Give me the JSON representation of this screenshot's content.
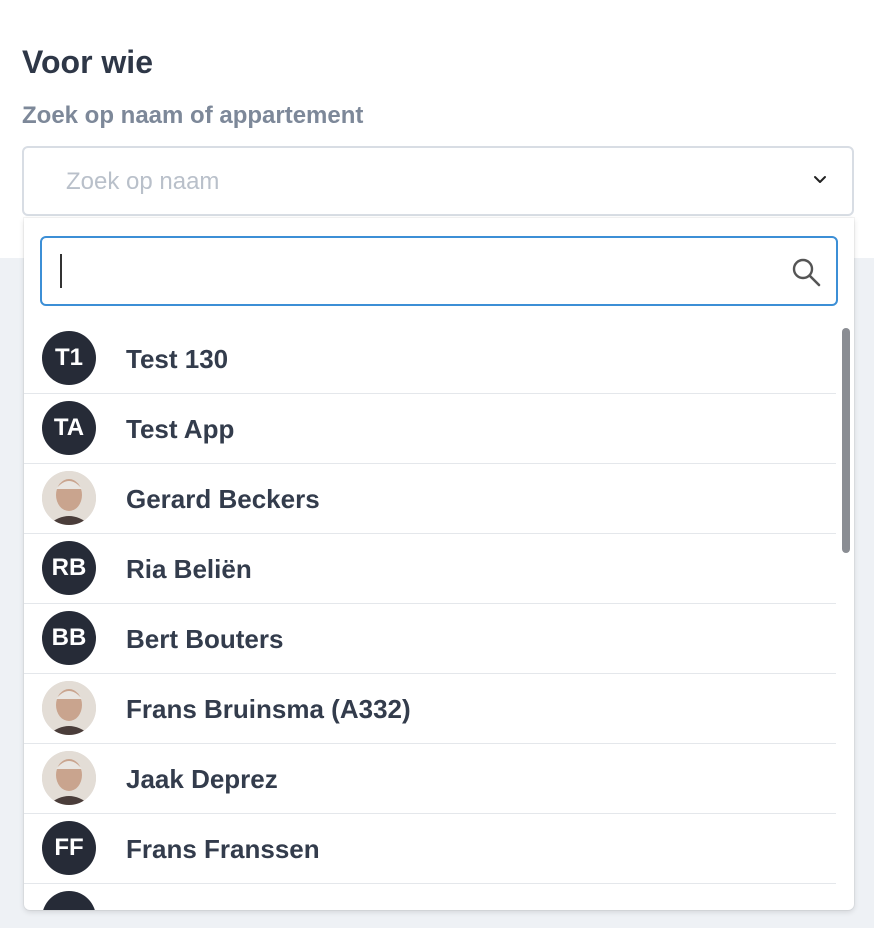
{
  "header": {
    "title": "Voor wie",
    "subtitle": "Zoek op naam of appartement"
  },
  "select": {
    "placeholder": "Zoek op naam",
    "chevron_icon": "chevron-down-icon"
  },
  "search": {
    "value": "",
    "icon": "search-icon"
  },
  "people": [
    {
      "initials": "T1",
      "name": "Test 130",
      "photo": false
    },
    {
      "initials": "TA",
      "name": "Test App",
      "photo": false
    },
    {
      "initials": "",
      "name": "Gerard Beckers",
      "photo": true
    },
    {
      "initials": "RB",
      "name": "Ria Beliën",
      "photo": false
    },
    {
      "initials": "BB",
      "name": "Bert Bouters",
      "photo": false
    },
    {
      "initials": "",
      "name": "Frans Bruinsma (A332)",
      "photo": true
    },
    {
      "initials": "",
      "name": "Jaak Deprez",
      "photo": true
    },
    {
      "initials": "FF",
      "name": "Frans Franssen",
      "photo": false
    },
    {
      "initials": "",
      "name": "",
      "photo": false
    }
  ]
}
